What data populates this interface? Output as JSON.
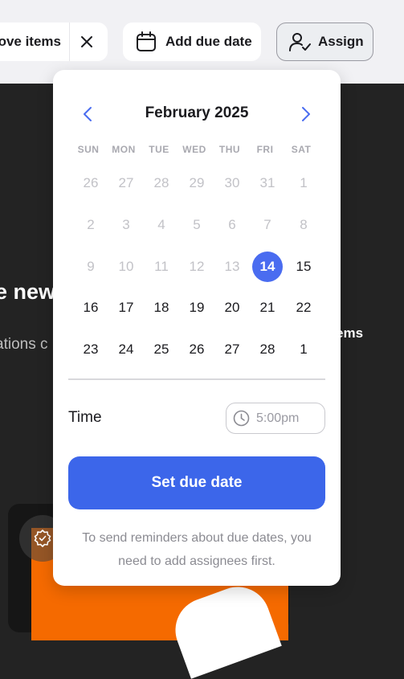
{
  "toolbar": {
    "move_label": "ove items",
    "due_label": "Add due date",
    "assign_label": "Assign"
  },
  "background": {
    "heading": "e new",
    "subtext": "ations c",
    "items_text": "ems"
  },
  "calendar": {
    "month_label": "February 2025",
    "weekdays": [
      "SUN",
      "MON",
      "TUE",
      "WED",
      "THU",
      "FRI",
      "SAT"
    ],
    "weeks": [
      [
        "26",
        "27",
        "28",
        "29",
        "30",
        "31",
        "1"
      ],
      [
        "2",
        "3",
        "4",
        "5",
        "6",
        "7",
        "8"
      ],
      [
        "9",
        "10",
        "11",
        "12",
        "13",
        "14",
        "15"
      ],
      [
        "16",
        "17",
        "18",
        "19",
        "20",
        "21",
        "22"
      ],
      [
        "23",
        "24",
        "25",
        "26",
        "27",
        "28",
        "1"
      ]
    ],
    "selected_day": "14",
    "accent_color": "#4a6cf0"
  },
  "time": {
    "label": "Time",
    "value": "5:00pm"
  },
  "set_button_label": "Set due date",
  "hint": "To send reminders about due dates, you need to add assignees first.",
  "icons": {
    "prev": "chevron-left-icon",
    "next": "chevron-right-icon",
    "calendar": "calendar-icon",
    "assign": "user-check-icon",
    "close": "close-icon",
    "clock": "clock-icon",
    "badge": "gear-badge-icon"
  }
}
